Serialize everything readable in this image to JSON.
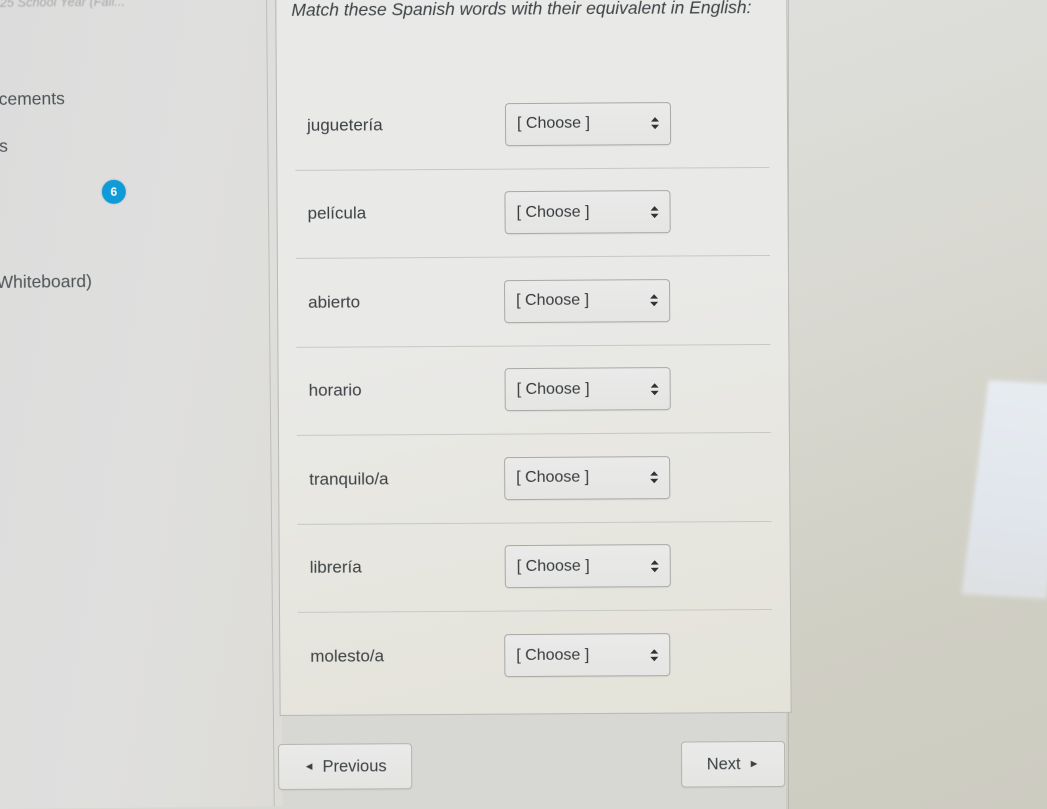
{
  "sidebar": {
    "course_title": "25 School Year (Fall...",
    "items": [
      {
        "label": "ncements"
      },
      {
        "label": "es"
      },
      {
        "label": "s"
      },
      {
        "label": "(Whiteboard)"
      }
    ],
    "badge": {
      "name": "unread-count",
      "value": "6",
      "color": "#0f9bd7"
    }
  },
  "quiz": {
    "prompt": "Match these Spanish words with their equivalent in English:",
    "choose_placeholder": "[ Choose ]",
    "rows": [
      {
        "term": "juguetería",
        "value": "[ Choose ]"
      },
      {
        "term": "película",
        "value": "[ Choose ]"
      },
      {
        "term": "abierto",
        "value": "[ Choose ]"
      },
      {
        "term": "horario",
        "value": "[ Choose ]"
      },
      {
        "term": "tranquilo/a",
        "value": "[ Choose ]"
      },
      {
        "term": "librería",
        "value": "[ Choose ]"
      },
      {
        "term": "molesto/a",
        "value": "[ Choose ]"
      }
    ]
  },
  "footer": {
    "previous_label": "Previous",
    "next_label": "Next",
    "prev_arrow": "◄",
    "next_arrow": "►"
  },
  "colors": {
    "page_background": "#d7d7d3",
    "sidebar_background": "#dedede",
    "card_background": "#e8e8e6",
    "accent_blue": "#0f9bd7",
    "text": "#3b4042",
    "divider": "#c8c8c4"
  }
}
